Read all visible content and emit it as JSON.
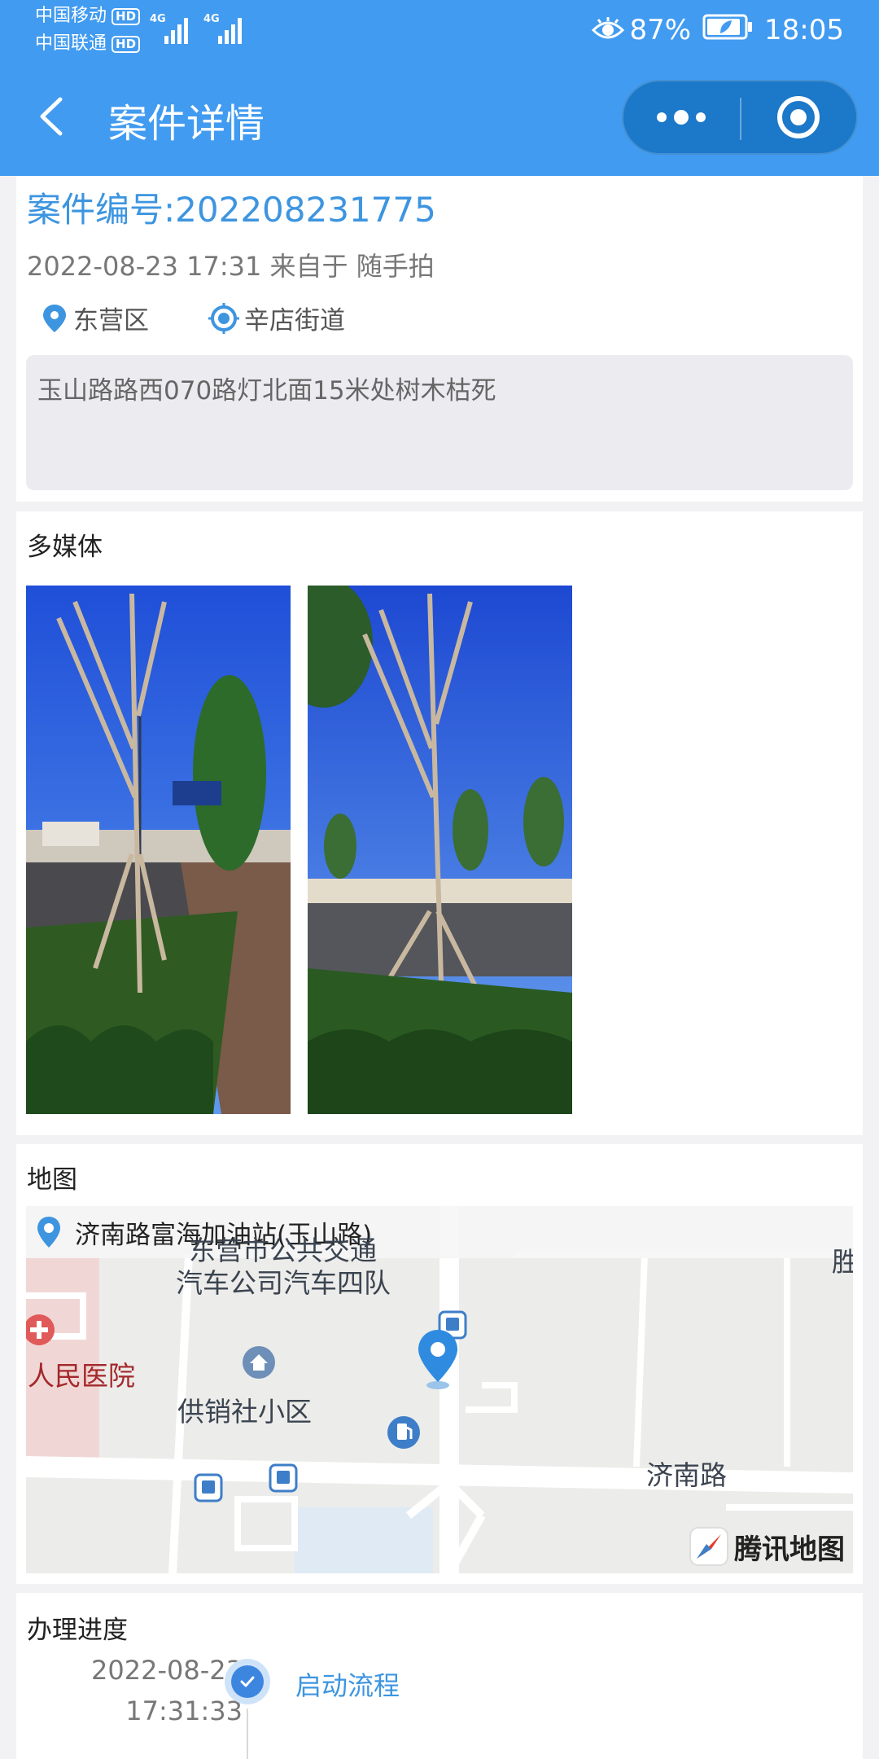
{
  "status_bar": {
    "carrier_1": "中国移动",
    "carrier_2": "中国联通",
    "hd_badge": "HD",
    "network_1": "4G",
    "network_2": "4G",
    "battery": "87%",
    "time": "18:05"
  },
  "nav": {
    "title": "案件详情"
  },
  "case": {
    "number": "案件编号:202208231775",
    "meta": "2022-08-23 17:31 来自于 随手拍",
    "district": "东营区",
    "street": "辛店街道",
    "description": "玉山路路西070路灯北面15米处树木枯死"
  },
  "media": {
    "title": "多媒体",
    "photos": [
      "photo-1",
      "photo-2"
    ]
  },
  "map": {
    "title": "地图",
    "address": "济南路富海加油站(玉山路)",
    "labels": {
      "bus_company_1": "东营市公共交通",
      "bus_company_2": "汽车公司汽车四队",
      "hospital": "人民医院",
      "community": "供销社小区",
      "road": "济南路",
      "edge": "胜"
    },
    "provider": "腾讯地图"
  },
  "progress": {
    "title": "办理进度",
    "steps": [
      {
        "date": "2022-08-23",
        "time": "17:31:33",
        "label": "启动流程"
      }
    ]
  },
  "colors": {
    "header": "#419bf0",
    "capsule": "#1c78c9",
    "accent_text": "#3d95e0",
    "hospital_text": "#a3282a"
  }
}
